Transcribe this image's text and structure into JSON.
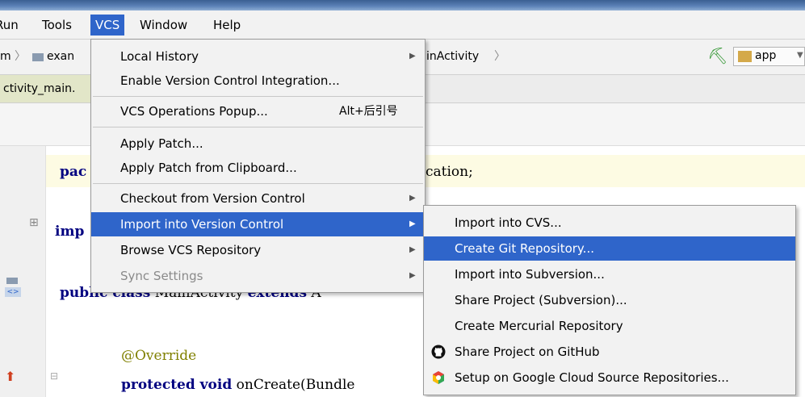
{
  "menubar": {
    "items": [
      {
        "label": "Run",
        "visible": "Run"
      },
      {
        "label": "Tools"
      },
      {
        "label": "VCS",
        "active": true
      },
      {
        "label": "Window"
      },
      {
        "label": "Help"
      }
    ]
  },
  "navbar": {
    "crumb1": "m",
    "crumb2": "exan",
    "crumb3": "inActivity",
    "run_config": "app"
  },
  "tabs": {
    "active_file": "ctivity_main."
  },
  "editor": {
    "line1": {
      "kw": "pac",
      "tail": "cation;"
    },
    "line2": {
      "kw": "imp"
    },
    "line3": {
      "kw1": "public class",
      "mid": " MainActivity ",
      "kw2": "extends",
      "tail": " A"
    },
    "line4": {
      "ann": "@Override"
    },
    "line5": {
      "kw": "protected void",
      "tail": " onCreate(Bundle "
    }
  },
  "vcs_menu": {
    "items": [
      {
        "label": "Local History",
        "submenu": true
      },
      {
        "label": "Enable Version Control Integration..."
      },
      {
        "label": "VCS Operations Popup...",
        "shortcut": "Alt+后引号"
      },
      {
        "label": "Apply Patch..."
      },
      {
        "label": "Apply Patch from Clipboard..."
      },
      {
        "label": "Checkout from Version Control",
        "submenu": true
      },
      {
        "label": "Import into Version Control",
        "submenu": true,
        "highlighted": true
      },
      {
        "label": "Browse VCS Repository",
        "submenu": true
      },
      {
        "label": "Sync Settings",
        "submenu": true,
        "disabled": true
      }
    ]
  },
  "import_submenu": {
    "items": [
      {
        "label": "Import into CVS..."
      },
      {
        "label": "Create Git Repository...",
        "highlighted": true
      },
      {
        "label": "Import into Subversion..."
      },
      {
        "label": "Share Project (Subversion)..."
      },
      {
        "label": "Create Mercurial Repository"
      },
      {
        "label": "Share Project on GitHub",
        "icon": "github-icon"
      },
      {
        "label": "Setup on Google Cloud Source Repositories...",
        "icon": "google-cloud-icon"
      }
    ]
  },
  "colors": {
    "highlight": "#2f65ca",
    "menu_bg": "#f2f2f2"
  }
}
